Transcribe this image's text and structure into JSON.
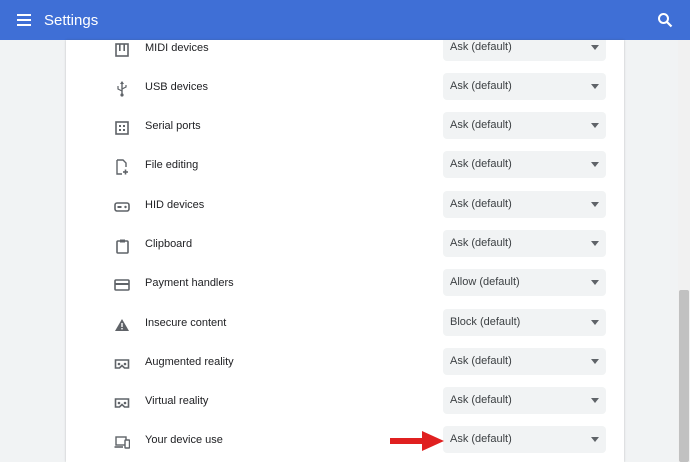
{
  "header": {
    "title": "Settings",
    "menu_icon": "hamburger-menu-icon",
    "search_icon": "search-icon",
    "bar_color": "#3f6fd6"
  },
  "rows": [
    {
      "label": "MIDI devices",
      "icon": "midi-keyboard-icon",
      "value": "Ask (default)"
    },
    {
      "label": "USB devices",
      "icon": "usb-icon",
      "value": "Ask (default)"
    },
    {
      "label": "Serial ports",
      "icon": "serial-port-icon",
      "value": "Ask (default)"
    },
    {
      "label": "File editing",
      "icon": "file-edit-icon",
      "value": "Ask (default)"
    },
    {
      "label": "HID devices",
      "icon": "gamepad-icon",
      "value": "Ask (default)"
    },
    {
      "label": "Clipboard",
      "icon": "clipboard-icon",
      "value": "Ask (default)"
    },
    {
      "label": "Payment handlers",
      "icon": "credit-card-icon",
      "value": "Allow (default)"
    },
    {
      "label": "Insecure content",
      "icon": "warning-icon",
      "value": "Block (default)"
    },
    {
      "label": "Augmented reality",
      "icon": "vr-headset-icon",
      "value": "Ask (default)"
    },
    {
      "label": "Virtual reality",
      "icon": "vr-headset-icon",
      "value": "Ask (default)"
    },
    {
      "label": "Your device use",
      "icon": "devices-icon",
      "value": "Ask (default)"
    }
  ],
  "annotation": {
    "icon": "red-arrow-icon",
    "color": "#e02020"
  }
}
